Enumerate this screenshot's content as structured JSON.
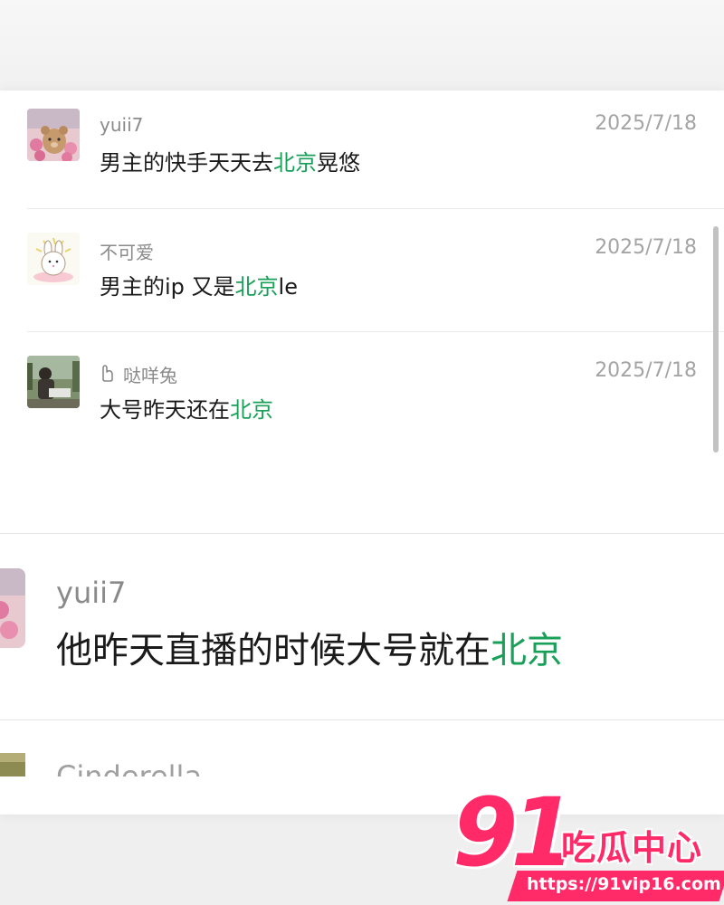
{
  "accent_color": "#18a058",
  "comments": [
    {
      "username": "yuii7",
      "date": "2025/7/18",
      "text_before": "男主的快手天天去",
      "highlight": "北京",
      "text_after": "晃悠"
    },
    {
      "username": "不可爱",
      "date": "2025/7/18",
      "text_before": "男主的ip 又是",
      "highlight": "北京",
      "text_after": "le"
    },
    {
      "username": "哒咩兔",
      "username_icon": "hand-icon",
      "date": "2025/7/18",
      "text_before": "大号昨天还在",
      "highlight": "北京",
      "text_after": ""
    }
  ],
  "zoomed_comment": {
    "username": "yuii7",
    "text_before": "他昨天直播的时候大号就在",
    "highlight": "北京"
  },
  "cut_comment": {
    "username": "Cinderella"
  },
  "watermark": {
    "number": "91",
    "brand": "吃瓜中心",
    "url": "https://91vip16.com"
  }
}
